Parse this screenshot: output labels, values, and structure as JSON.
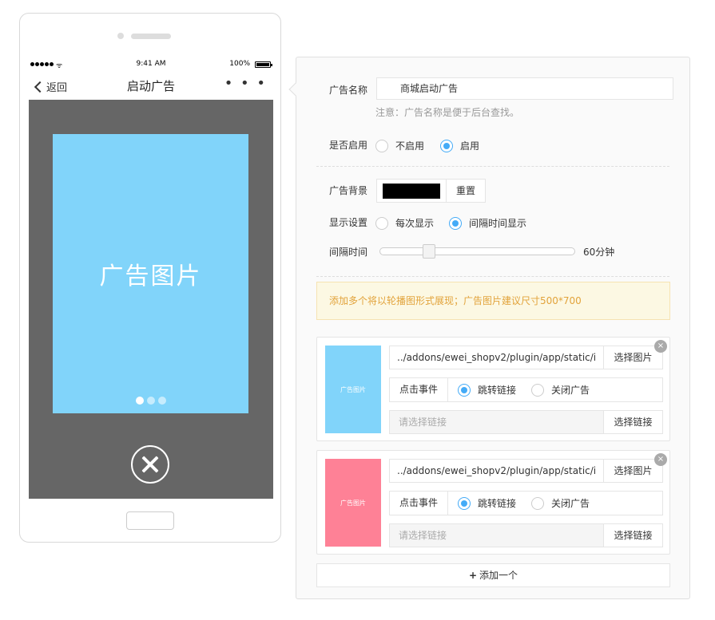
{
  "phone": {
    "status_time": "9:41 AM",
    "battery": "100%",
    "back_label": "返回",
    "title": "启动广告",
    "more": "• • •",
    "ad_image_label": "广告图片",
    "carousel_dot_count": 3,
    "carousel_active_index": 0
  },
  "form": {
    "name_label": "广告名称",
    "name_value": "商城启动广告",
    "name_hint": "注意：广告名称是便于后台查找。",
    "enable_label": "是否启用",
    "enable_options": [
      "不启用",
      "启用"
    ],
    "enable_selected": "启用",
    "bg_label": "广告背景",
    "bg_color": "#000000",
    "reset_label": "重置",
    "display_label": "显示设置",
    "display_options": [
      "每次显示",
      "间隔时间显示"
    ],
    "display_selected": "间隔时间显示",
    "interval_label": "间隔时间",
    "interval_value": 60,
    "interval_max": 240,
    "interval_text": "60分钟",
    "notice": "添加多个将以轮播图形式展现；广告图片建议尺寸500*700"
  },
  "ads": [
    {
      "thumb_label": "广告图片",
      "thumb_color": "#81d4fa",
      "image_path": "../addons/ewei_shopv2/plugin/app/static/i",
      "select_image_label": "选择图片",
      "event_label": "点击事件",
      "event_options": [
        "跳转链接",
        "关闭广告"
      ],
      "event_selected": "跳转链接",
      "link_placeholder": "请选择链接",
      "select_link_label": "选择链接",
      "close_icon": "×"
    },
    {
      "thumb_label": "广告图片",
      "thumb_color": "#fe8196",
      "image_path": "../addons/ewei_shopv2/plugin/app/static/i",
      "select_image_label": "选择图片",
      "event_label": "点击事件",
      "event_options": [
        "跳转链接",
        "关闭广告"
      ],
      "event_selected": "跳转链接",
      "link_placeholder": "请选择链接",
      "select_link_label": "选择链接",
      "close_icon": "×"
    }
  ],
  "add_button": {
    "icon": "+",
    "label": "添加一个"
  },
  "colors": {
    "accent": "#44abf7",
    "screen_bg": "#666666",
    "notice_text": "#e2a33b",
    "notice_bg": "#fcf8e3"
  }
}
